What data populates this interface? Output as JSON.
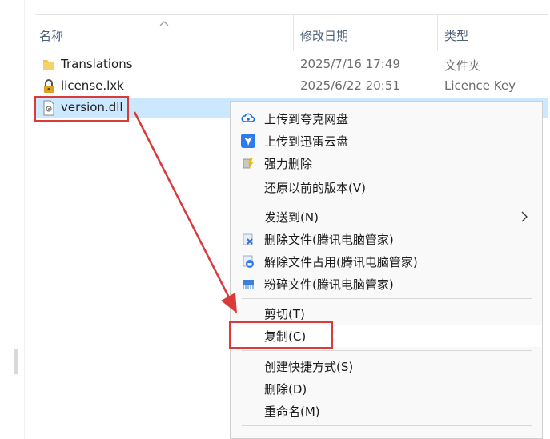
{
  "columns": {
    "name": "名称",
    "date": "修改日期",
    "type": "类型"
  },
  "files": [
    {
      "name": "Translations",
      "date": "2025/7/16 17:49",
      "type": "文件夹",
      "icon": "folder-icon"
    },
    {
      "name": "license.lxk",
      "date": "2025/6/22 20:51",
      "type": "Licence Key",
      "icon": "lock-file-icon"
    },
    {
      "name": "version.dll",
      "date": "",
      "type": "",
      "icon": "dll-file-icon"
    }
  ],
  "context_menu": {
    "items": [
      {
        "label": "上传到夸克网盘",
        "icon": "quark-cloud-icon"
      },
      {
        "label": "上传到迅雷云盘",
        "icon": "xunlei-icon"
      },
      {
        "label": "强力删除",
        "icon": "force-delete-icon"
      },
      {
        "label": "还原以前的版本(V)",
        "icon": ""
      },
      {
        "label": "发送到(N)",
        "icon": "",
        "submenu": true
      },
      {
        "label": "删除文件(腾讯电脑管家)",
        "icon": "tencent-delete-icon"
      },
      {
        "label": "解除文件占用(腾讯电脑管家)",
        "icon": "tencent-unlock-icon"
      },
      {
        "label": "粉碎文件(腾讯电脑管家)",
        "icon": "tencent-shred-icon"
      },
      {
        "label": "剪切(T)",
        "icon": ""
      },
      {
        "label": "复制(C)",
        "icon": ""
      },
      {
        "label": "创建快捷方式(S)",
        "icon": ""
      },
      {
        "label": "删除(D)",
        "icon": ""
      },
      {
        "label": "重命名(M)",
        "icon": ""
      }
    ]
  },
  "colors": {
    "selection": "#cce8ff",
    "annotation": "#d93a3a",
    "menu_bg": "#f9f9f9",
    "header_text": "#4c607a"
  }
}
